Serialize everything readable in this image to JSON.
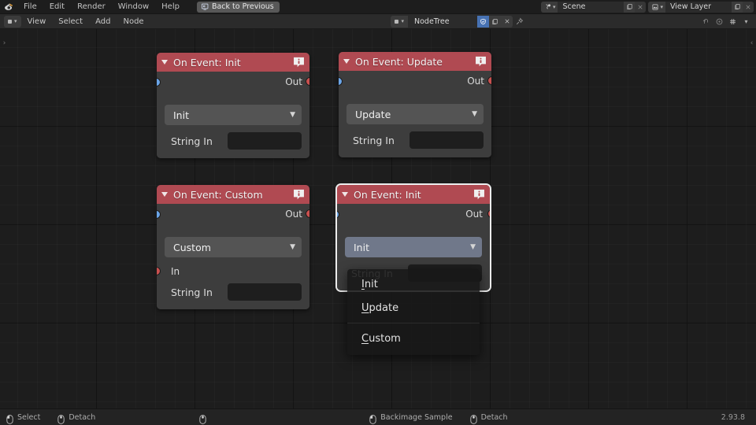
{
  "topbar": {
    "logo_icon": "blender-logo-icon",
    "menus": [
      "File",
      "Edit",
      "Render",
      "Window",
      "Help"
    ],
    "back_to_previous": {
      "label": "Back to Previous",
      "icon": "screen-back-icon"
    },
    "scene": {
      "icon": "scene-icon",
      "name": "Scene",
      "new_icon": "new-copy-icon",
      "unlink_icon": "x-icon"
    },
    "view_layer": {
      "icon": "view-layer-icon",
      "name": "View Layer",
      "new_icon": "new-copy-icon",
      "unlink_icon": "x-icon"
    }
  },
  "editor_header": {
    "editor_type_icon": "node-editor-icon",
    "menus": [
      "View",
      "Select",
      "Add",
      "Node"
    ],
    "tree_type_icon": "node-tree-icon",
    "tree_name": "NodeTree",
    "shield_icon": "fake-user-icon",
    "copy_icon": "new-copy-icon",
    "unlink_icon": "x-icon",
    "pin_icon": "pin-icon",
    "right_icons": [
      "snap-icon",
      "proportional-icon",
      "overlay-grid-icon",
      "chevron-down-icon"
    ]
  },
  "canvas": {
    "left_arrow_icon": "chevron-right-icon",
    "right_arrow_icon": "chevron-left-icon"
  },
  "nodes": [
    {
      "id": "node-on-event-init",
      "title": "On Event: Init",
      "collapse_icon": "triangle-down-icon",
      "info_icon": "info-bubble-icon",
      "header_color": "#b04a52",
      "output_label": "Out",
      "output_socket_color": "#c9504f",
      "dropdown_value": "Init",
      "chevron_icon": "chevron-down-icon",
      "string_label": "String In",
      "string_value": "",
      "string_socket_color": "#6ba5e8",
      "has_in_socket": false,
      "selected": false
    },
    {
      "id": "node-on-event-update",
      "title": "On Event: Update",
      "collapse_icon": "triangle-down-icon",
      "info_icon": "info-bubble-icon",
      "header_color": "#b04a52",
      "output_label": "Out",
      "output_socket_color": "#c9504f",
      "dropdown_value": "Update",
      "chevron_icon": "chevron-down-icon",
      "string_label": "String In",
      "string_value": "",
      "string_socket_color": "#6ba5e8",
      "has_in_socket": false,
      "selected": false
    },
    {
      "id": "node-on-event-custom",
      "title": "On Event: Custom",
      "collapse_icon": "triangle-down-icon",
      "info_icon": "info-bubble-icon",
      "header_color": "#b04a52",
      "output_label": "Out",
      "output_socket_color": "#c9504f",
      "dropdown_value": "Custom",
      "chevron_icon": "chevron-down-icon",
      "in_label": "In",
      "in_socket_color": "#c9504f",
      "string_label": "String In",
      "string_value": "",
      "string_socket_color": "#6ba5e8",
      "has_in_socket": true,
      "selected": false
    },
    {
      "id": "node-on-event-init-active",
      "title": "On Event: Init",
      "collapse_icon": "triangle-down-icon",
      "info_icon": "info-bubble-icon",
      "header_color": "#b04a52",
      "output_label": "Out",
      "output_socket_color": "#c9504f",
      "dropdown_value": "Init",
      "chevron_icon": "chevron-down-icon",
      "string_label": "String In",
      "string_value": "",
      "string_socket_color": "#6ba5e8",
      "has_in_socket": false,
      "selected": true
    }
  ],
  "open_dropdown": {
    "selected_value": "Init",
    "chevron_icon": "chevron-down-icon",
    "items": [
      {
        "label": "Init",
        "accel": "I"
      },
      {
        "label": "Update",
        "accel": "U"
      },
      {
        "label": "Custom",
        "accel": "C",
        "separator_before": true
      }
    ]
  },
  "statusbar": {
    "items": [
      {
        "icon": "mouse-left-icon",
        "label": "Select"
      },
      {
        "icon": "mouse-middle-icon",
        "label": "Detach"
      },
      {
        "icon": "mouse-plain-icon",
        "label": ""
      },
      {
        "icon": "mouse-left-icon",
        "label": "Backimage Sample"
      },
      {
        "icon": "mouse-middle-icon",
        "label": "Detach"
      }
    ],
    "version": "2.93.8"
  }
}
